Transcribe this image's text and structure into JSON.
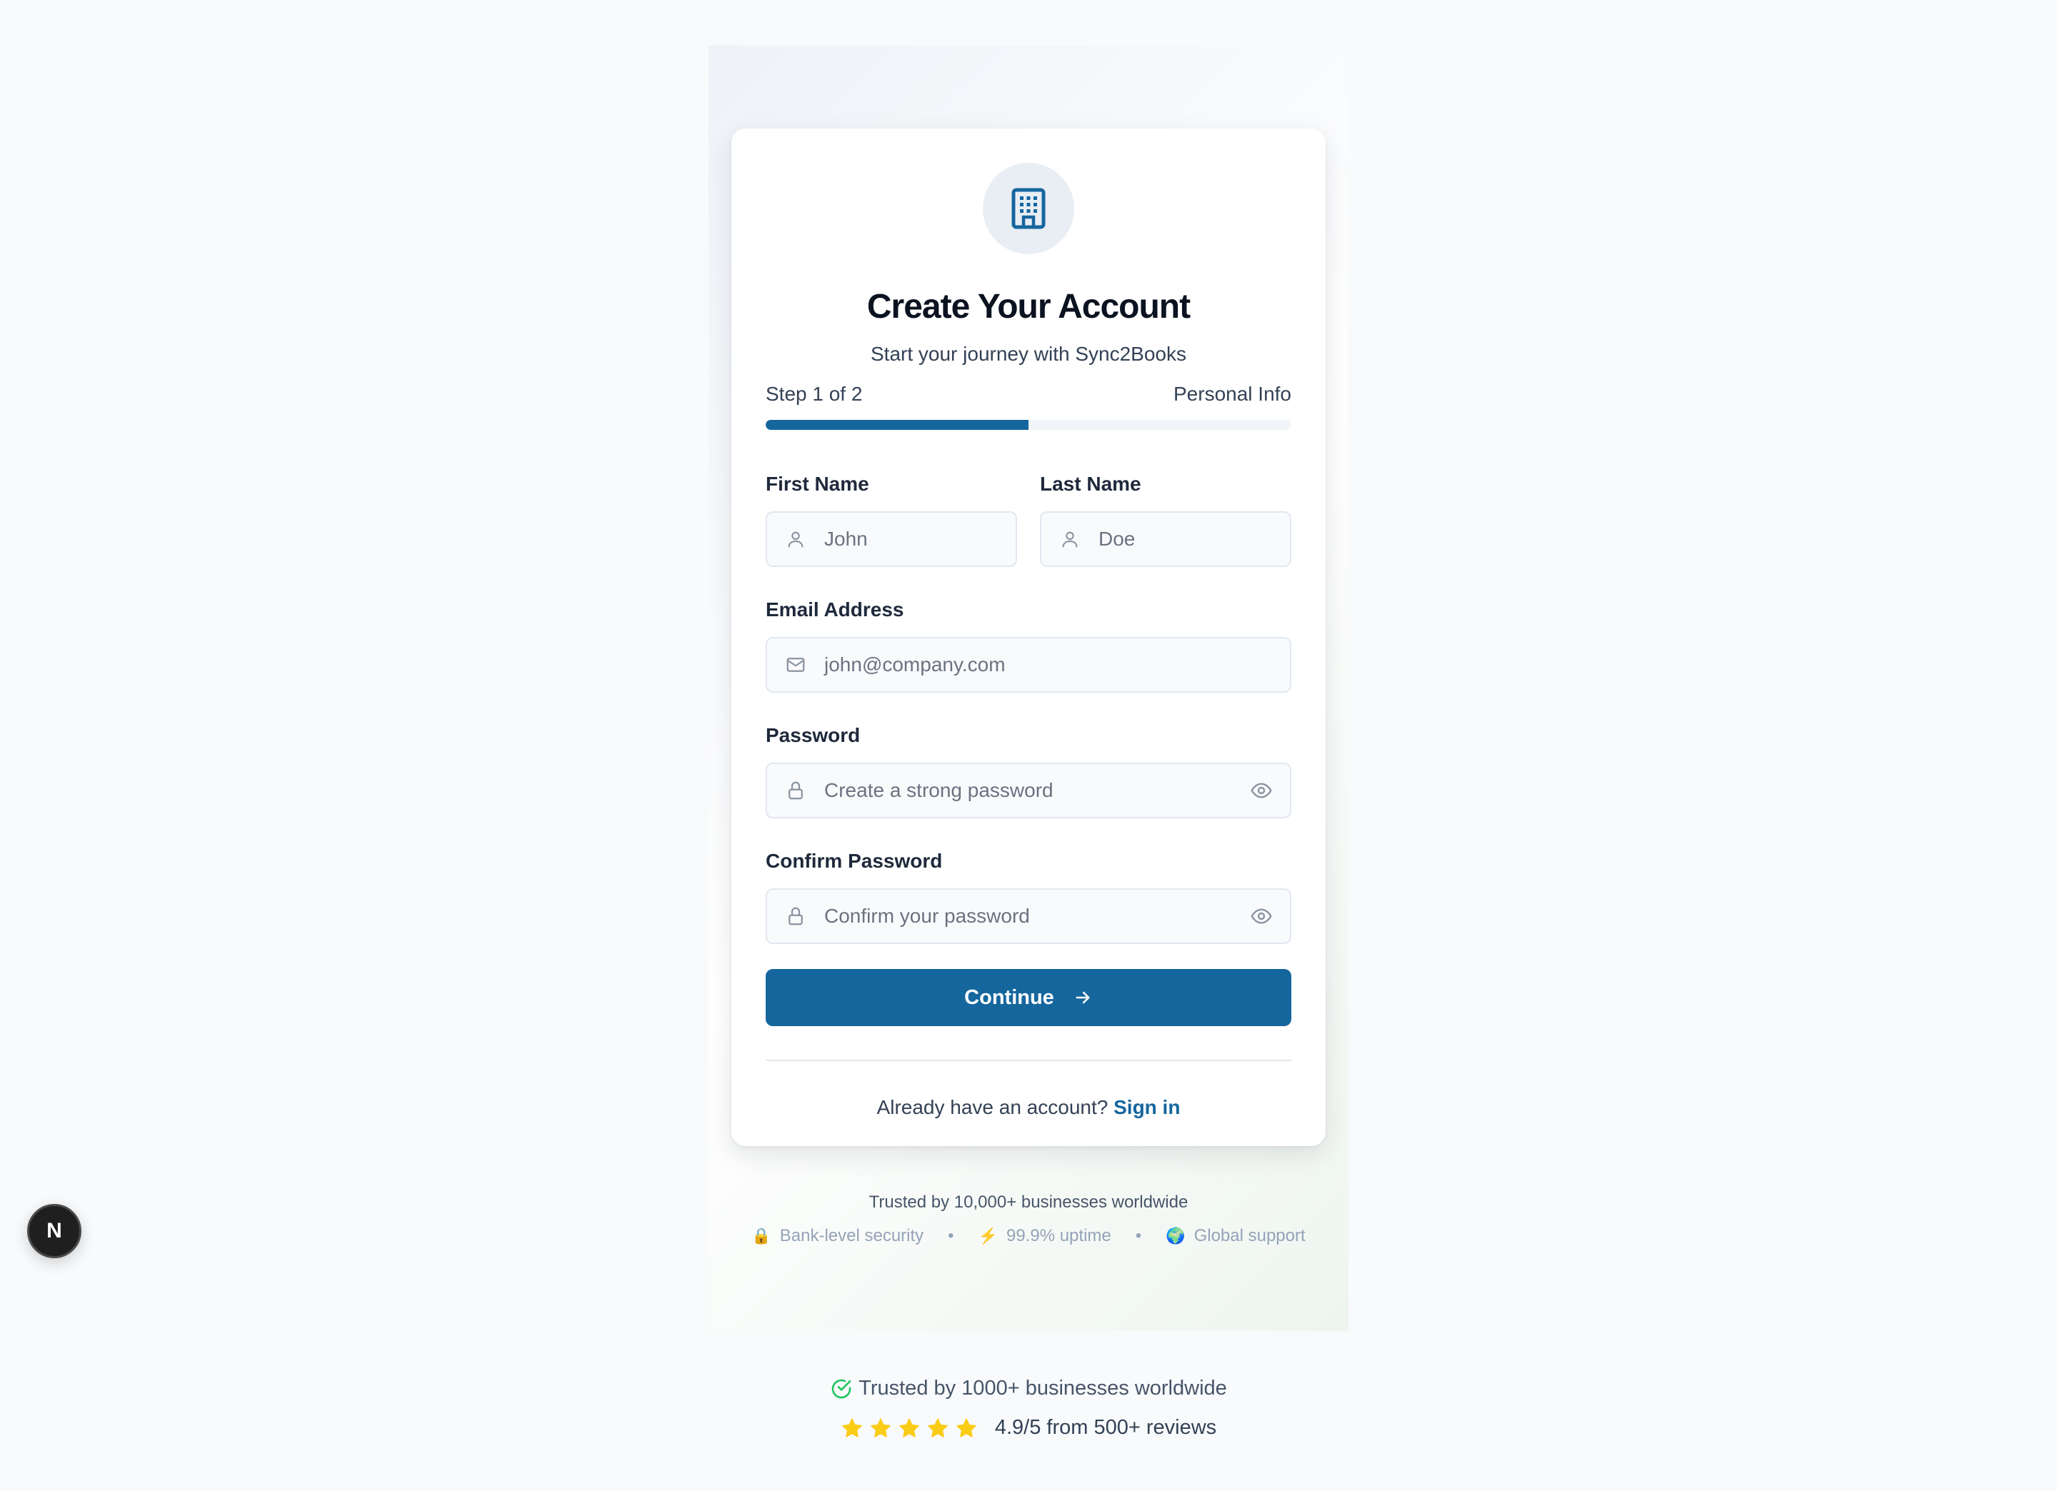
{
  "card": {
    "title": "Create Your Account",
    "subtitle": "Start your journey with Sync2Books"
  },
  "progress": {
    "step_label": "Step 1 of 2",
    "section_label": "Personal Info",
    "fraction": 0.5
  },
  "form": {
    "first_name": {
      "label": "First Name",
      "placeholder": "John",
      "icon": "user-icon"
    },
    "last_name": {
      "label": "Last Name",
      "placeholder": "Doe",
      "icon": "user-icon"
    },
    "email": {
      "label": "Email Address",
      "placeholder": "john@company.com",
      "icon": "mail-icon"
    },
    "password": {
      "label": "Password",
      "placeholder": "Create a strong password",
      "icon": "lock-icon"
    },
    "confirm_password": {
      "label": "Confirm Password",
      "placeholder": "Confirm your password",
      "icon": "lock-icon"
    },
    "submit_label": "Continue"
  },
  "signin": {
    "prompt": "Already have an account?",
    "link": "Sign in"
  },
  "trust": {
    "headline": "Trusted by 10,000+ businesses worldwide",
    "features": [
      {
        "icon": "🔒",
        "label": "Bank-level security"
      },
      {
        "icon": "⚡",
        "label": "99.9% uptime"
      },
      {
        "icon": "🌍",
        "label": "Global support"
      }
    ],
    "separator": "•"
  },
  "badge": {
    "letter": "N"
  },
  "footer": {
    "trusted": "Trusted by 1000+ businesses worldwide",
    "rating": "4.9/5 from 500+ reviews",
    "stars": 5
  },
  "colors": {
    "primary": "#16669e",
    "star": "#facc15",
    "success": "#22c55e"
  }
}
